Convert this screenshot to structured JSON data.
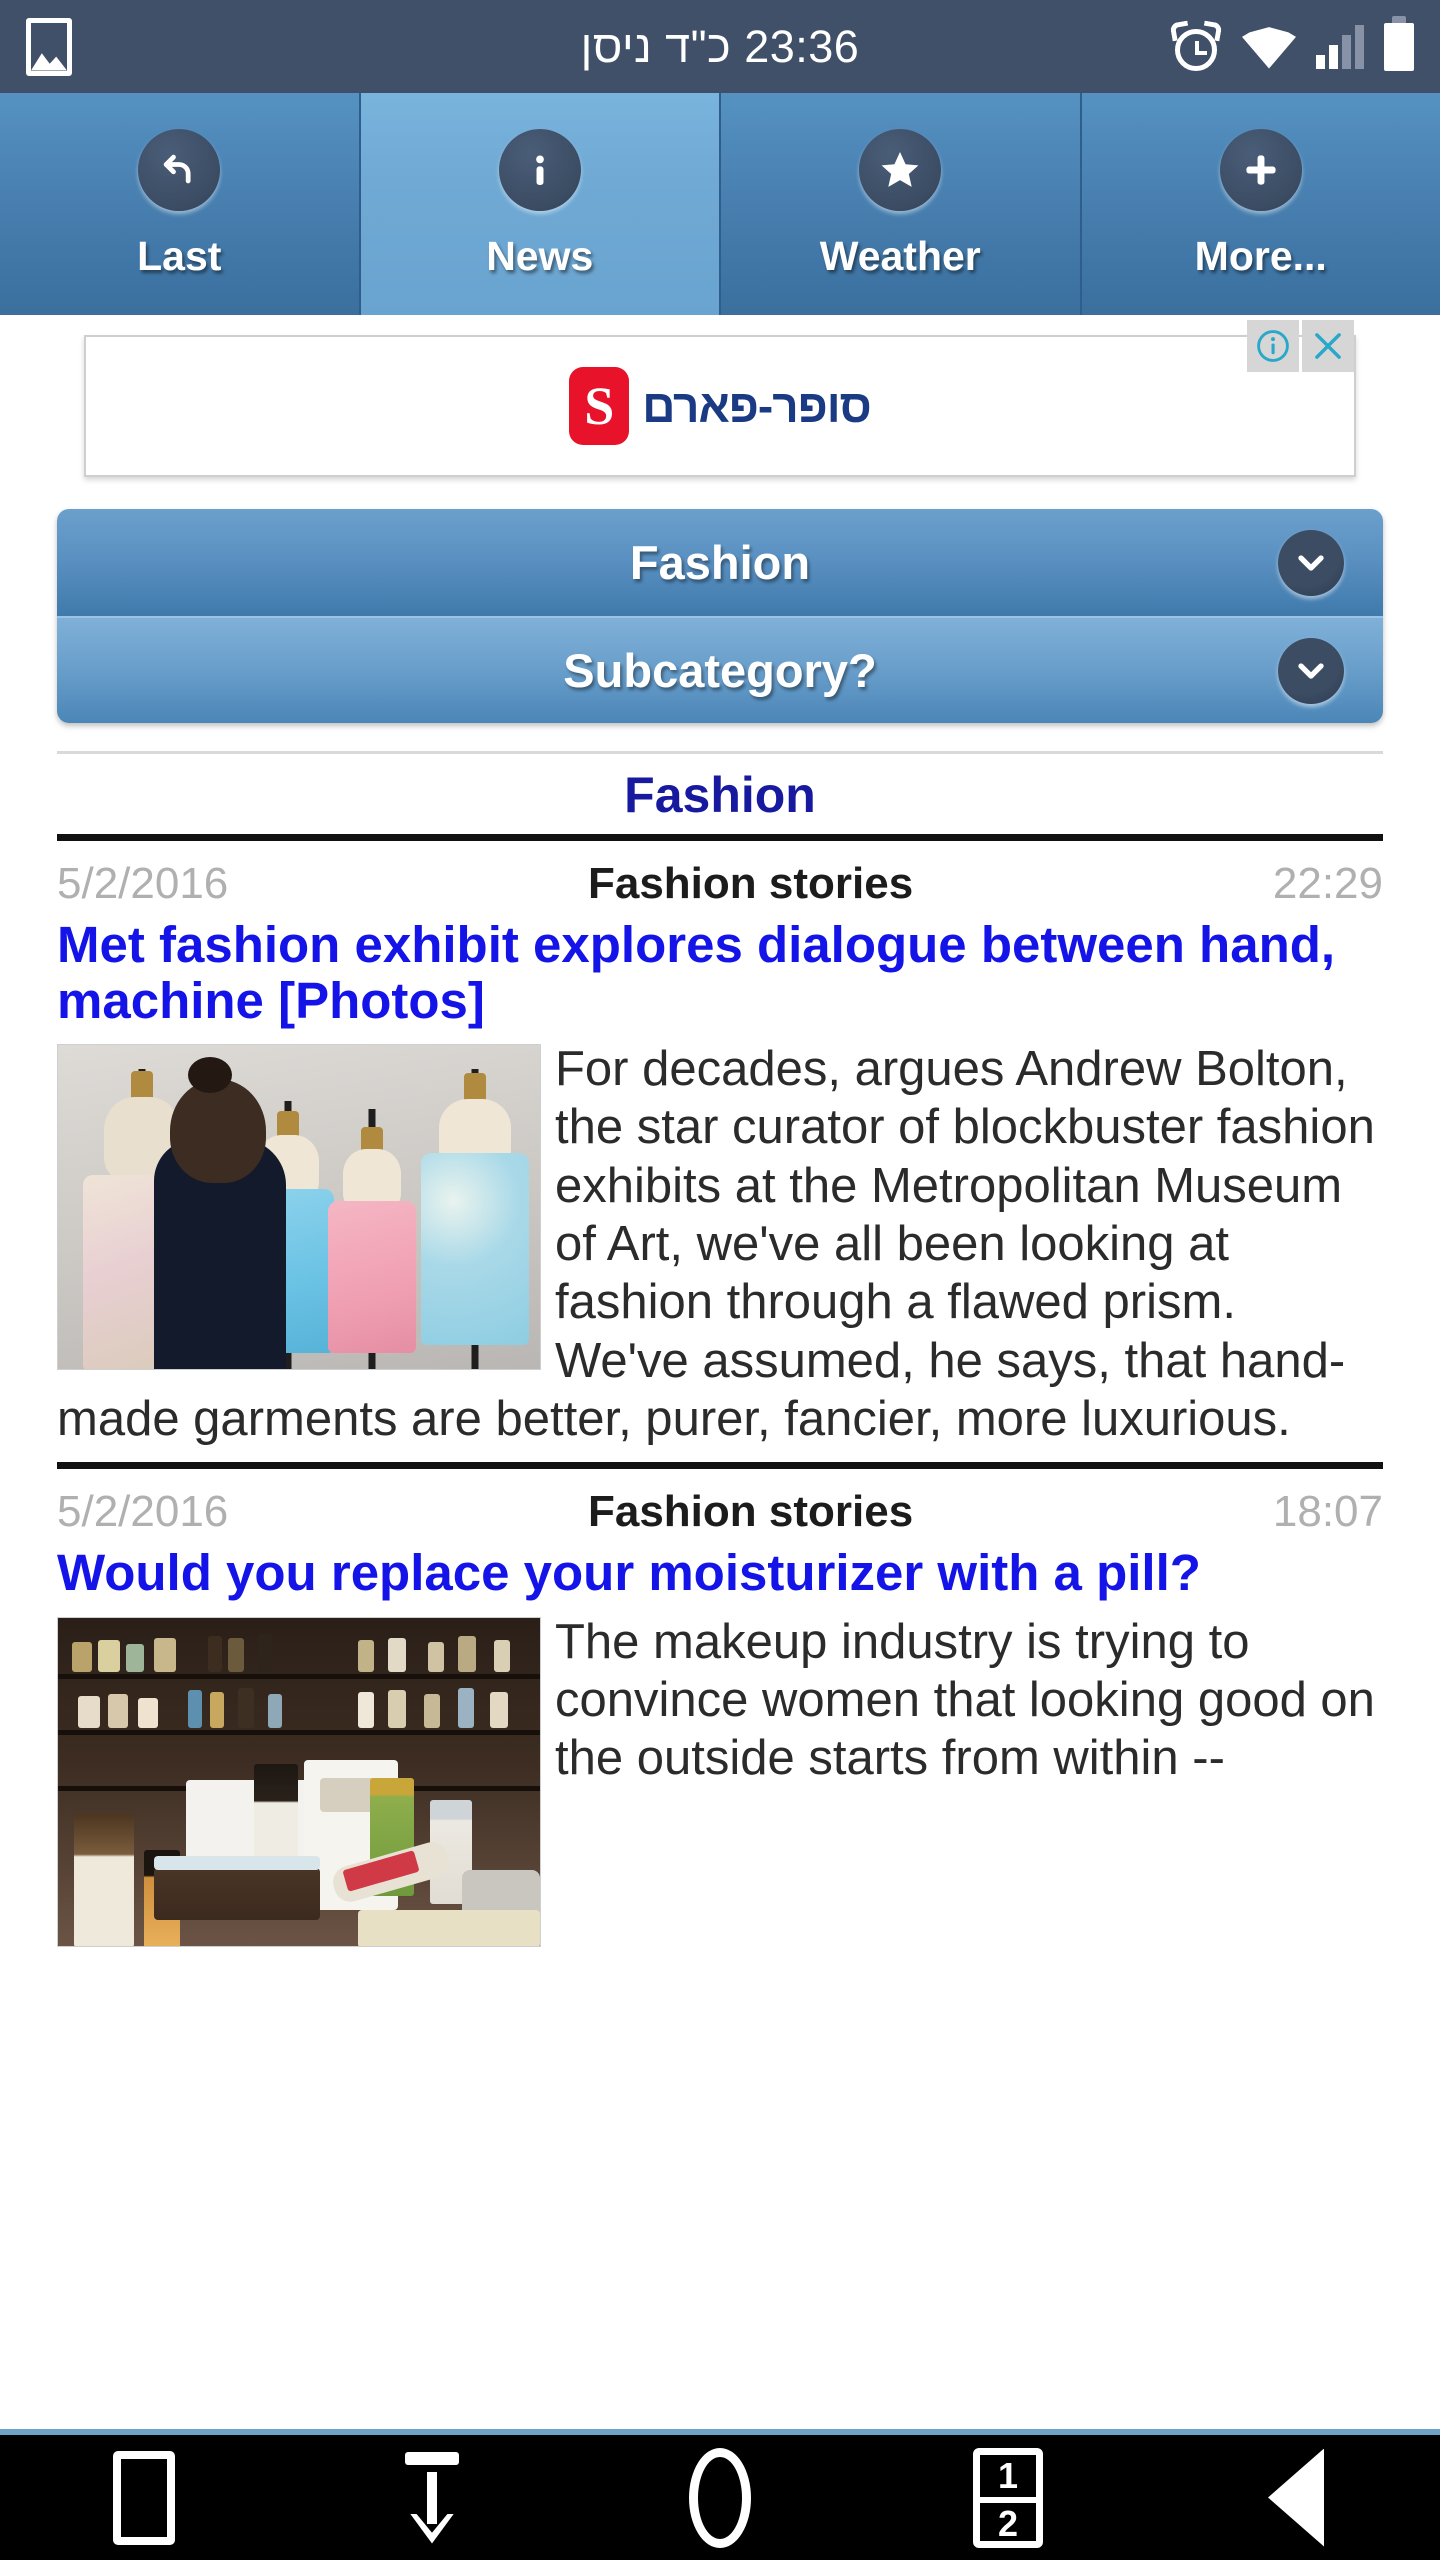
{
  "statusbar": {
    "time": "23:36",
    "hebrew_date": "כ\"ד ניסן",
    "center_text": "23:36 כ\"ד ניסן",
    "icons": {
      "left": "photo-icon",
      "alarm": "alarm-clock-icon",
      "wifi": "wifi-icon",
      "signal": "signal-bars-icon",
      "battery": "battery-icon"
    },
    "background_color": "#415069"
  },
  "tabbar": {
    "tabs": [
      {
        "label": "Last",
        "icon": "undo-arrow-icon",
        "active": false
      },
      {
        "label": "News",
        "icon": "info-icon",
        "active": true
      },
      {
        "label": "Weather",
        "icon": "star-icon",
        "active": false
      },
      {
        "label": "More...",
        "icon": "plus-icon",
        "active": false
      }
    ],
    "active_color": "#6fa9d4",
    "inactive_color": "#4a82b3"
  },
  "ad": {
    "advertiser": "סופר-פארם",
    "logo_mark": "S",
    "logo_color": "#e8122a",
    "text_color": "#1b3a84",
    "info_icon": "ad-info-icon",
    "close_icon": "ad-close-icon",
    "control_color": "#29a8ca"
  },
  "selectors": {
    "category": {
      "label": "Fashion",
      "icon": "chevron-down-icon"
    },
    "subcategory": {
      "label": "Subcategory?",
      "icon": "chevron-down-icon"
    }
  },
  "section": {
    "title": "Fashion",
    "title_color": "#17199e"
  },
  "articles": [
    {
      "date": "5/2/2016",
      "source": "Fashion stories",
      "time": "22:29",
      "headline": "Met fashion exhibit explores dialogue between hand, machine [Photos]",
      "body": "For decades, argues Andrew Bolton, the star curator of blockbuster fashion exhibits at the Metropolitan Museum of Art, we've all been looking at fashion through a flawed prism. We've assumed, he says, that hand-made garments are better, purer, fancier, more luxurious.",
      "thumbnail": "mannequins-with-dresses-photo"
    },
    {
      "date": "5/2/2016",
      "source": "Fashion stories",
      "time": "18:07",
      "headline": "Would you replace your moisturizer with a pill?",
      "body": "The makeup industry is trying to convince women that looking good on the outside starts from within --",
      "thumbnail": "skincare-products-shelf-photo"
    }
  ],
  "navbar": {
    "buttons": [
      {
        "name": "recent-apps-button",
        "icon": "square-icon",
        "label": ""
      },
      {
        "name": "download-button",
        "icon": "download-arrow-icon",
        "label": ""
      },
      {
        "name": "home-button",
        "icon": "circle-icon",
        "label": ""
      },
      {
        "name": "split-screen-button",
        "icon": "split-screen-icon",
        "label": "1 2"
      },
      {
        "name": "back-button",
        "icon": "back-triangle-icon",
        "label": ""
      }
    ],
    "split_top": "1",
    "split_bottom": "2",
    "background_color": "#000000"
  }
}
